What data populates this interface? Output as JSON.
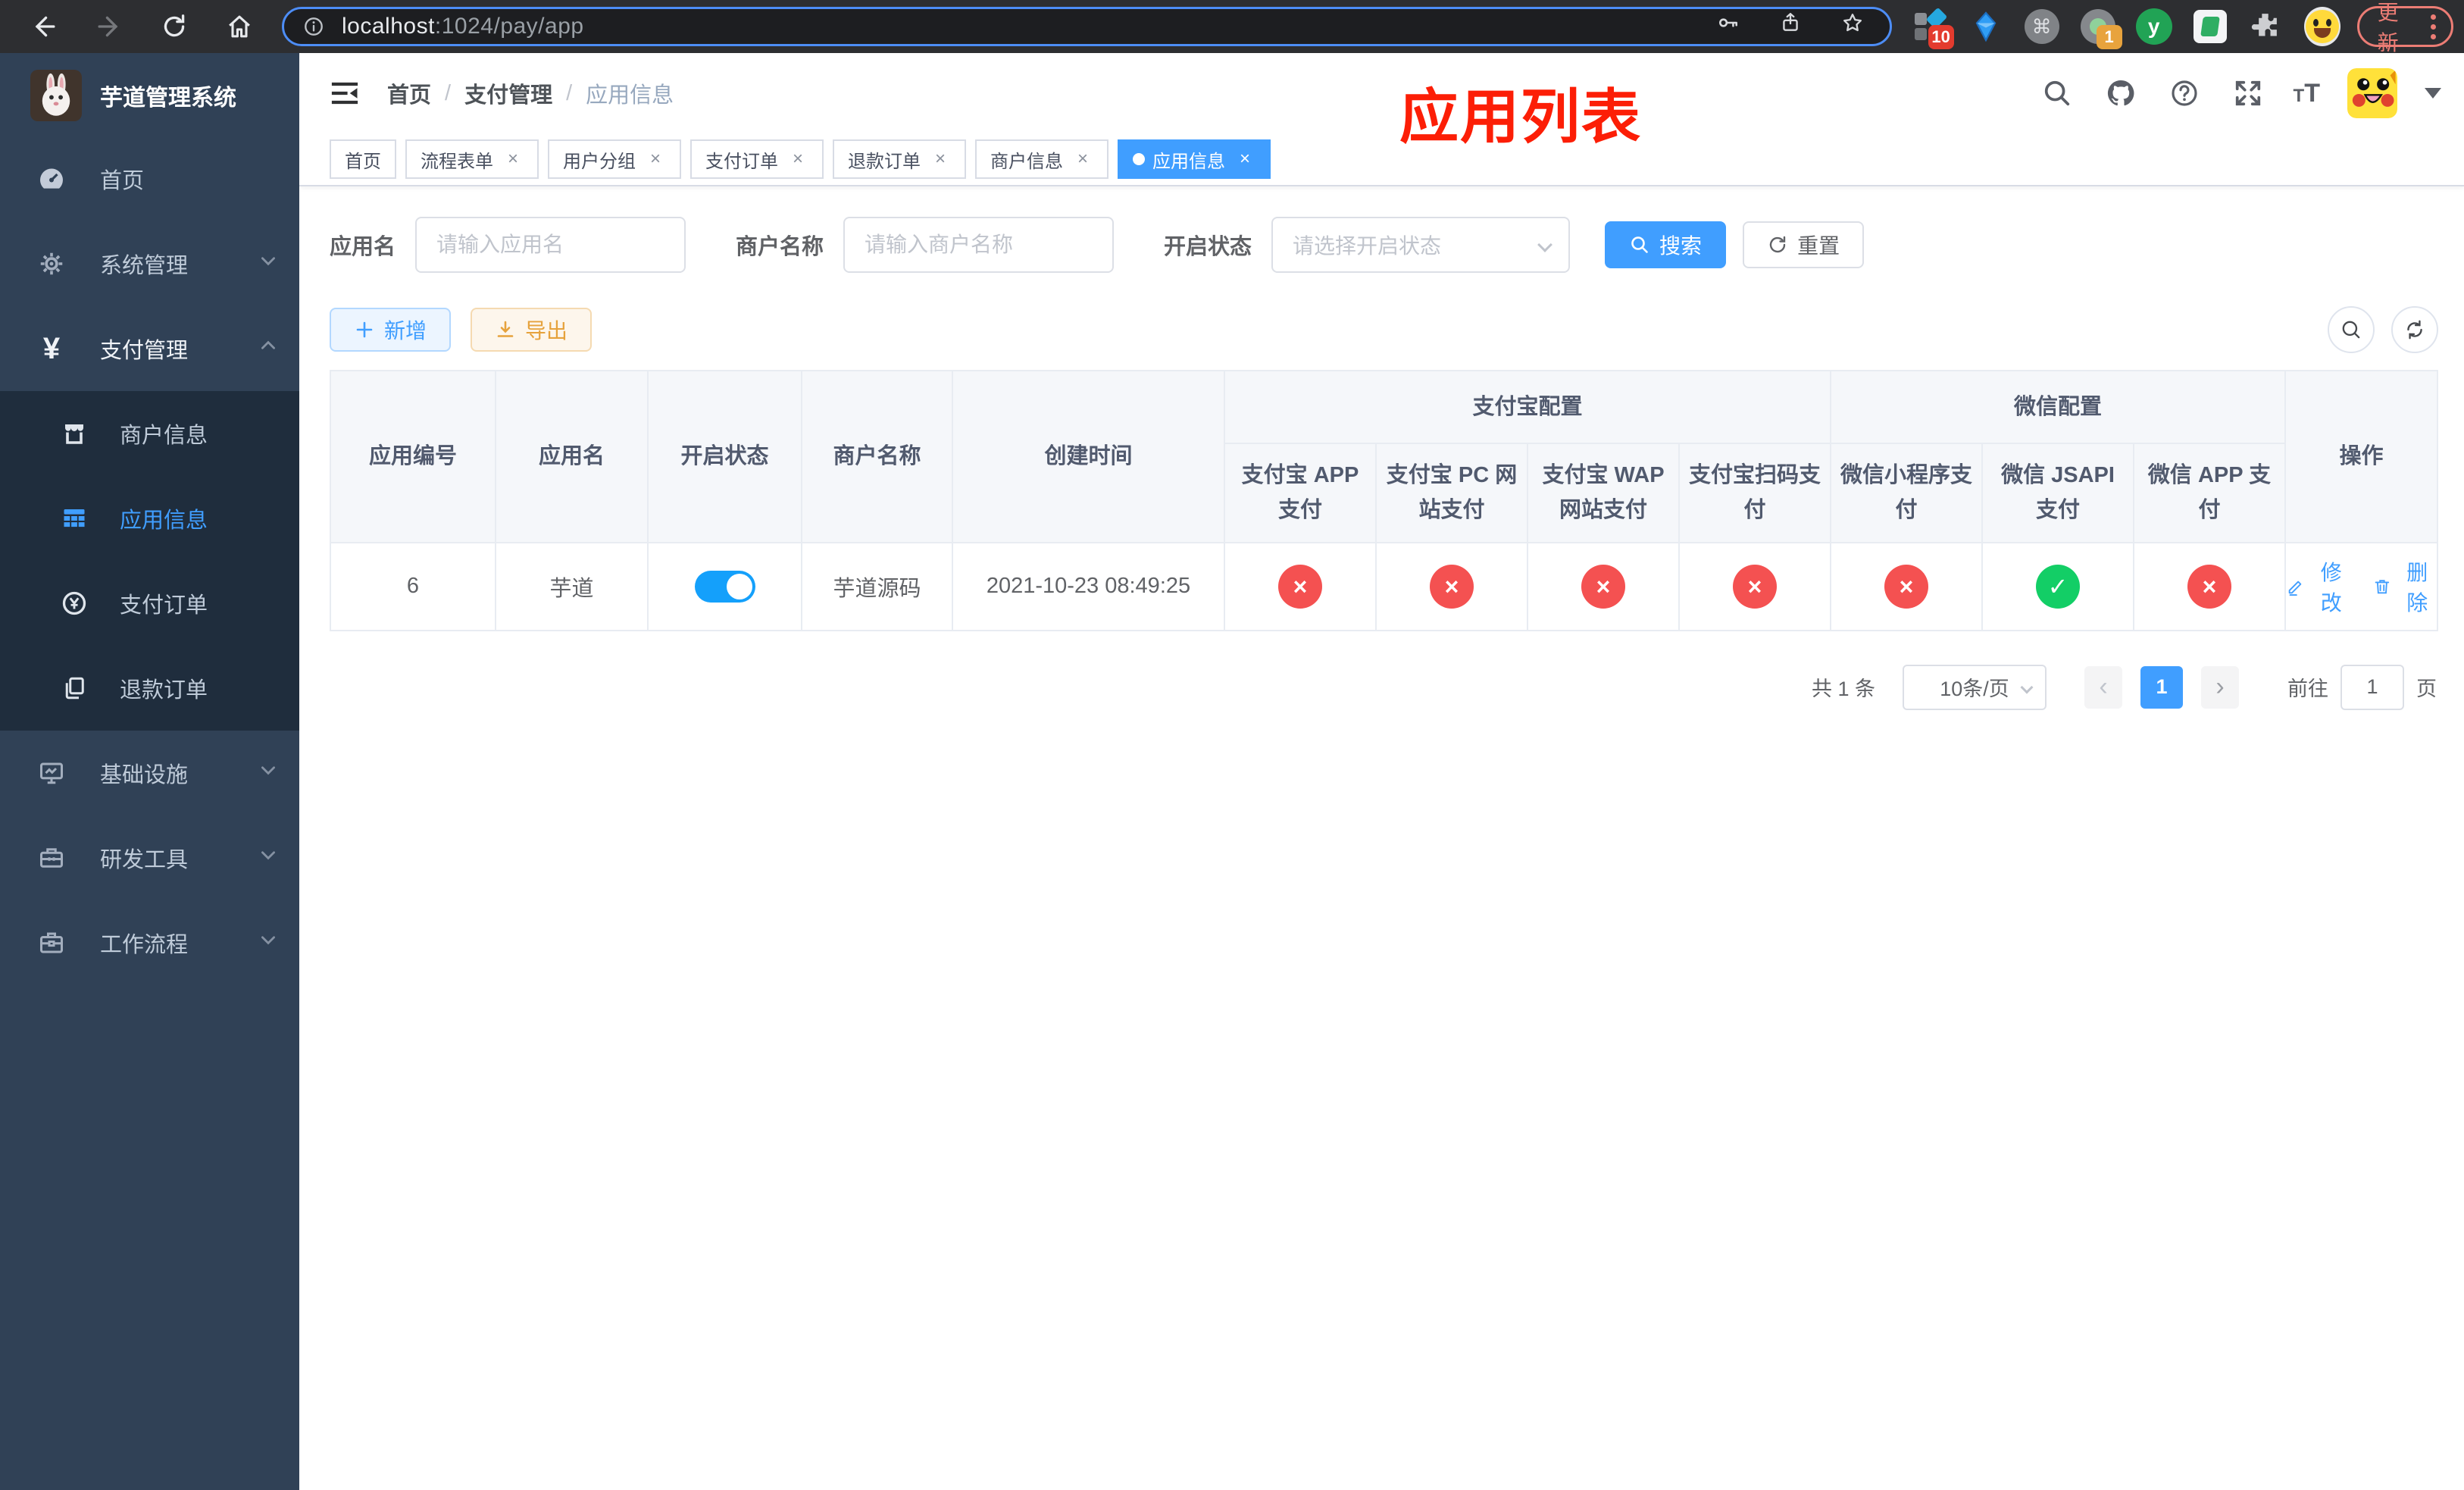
{
  "browser": {
    "url_host": "localhost",
    "url_rest": ":1024/pay/app",
    "ext_grid_badge": "10",
    "ext_avatar_badge": "1",
    "ext_y_glyph": "y",
    "ext_cmd_glyph": "⌘",
    "update_label": "更新"
  },
  "sidebar": {
    "title": "芋道管理系统",
    "items": [
      {
        "label": "首页"
      },
      {
        "label": "系统管理"
      },
      {
        "label": "支付管理"
      },
      {
        "label": "基础设施"
      },
      {
        "label": "研发工具"
      },
      {
        "label": "工作流程"
      }
    ],
    "submenu": [
      {
        "label": "商户信息"
      },
      {
        "label": "应用信息",
        "active": true
      },
      {
        "label": "支付订单"
      },
      {
        "label": "退款订单"
      }
    ]
  },
  "header": {
    "breadcrumb": [
      "首页",
      "支付管理",
      "应用信息"
    ],
    "separator": "/",
    "annotation": "应用列表"
  },
  "tabs": [
    {
      "label": "首页"
    },
    {
      "label": "流程表单"
    },
    {
      "label": "用户分组"
    },
    {
      "label": "支付订单"
    },
    {
      "label": "退款订单"
    },
    {
      "label": "商户信息"
    },
    {
      "label": "应用信息"
    }
  ],
  "tab_close_glyph": "×",
  "filters": {
    "app_name_label": "应用名",
    "app_name_placeholder": "请输入应用名",
    "merchant_label": "商户名称",
    "merchant_placeholder": "请输入商户名称",
    "status_label": "开启状态",
    "status_placeholder": "请选择开启状态",
    "search_label": "搜索",
    "reset_label": "重置"
  },
  "toolbar": {
    "add_label": "新增",
    "export_label": "导出"
  },
  "table": {
    "group_alipay": "支付宝配置",
    "group_wechat": "微信配置",
    "columns": [
      "应用编号",
      "应用名",
      "开启状态",
      "商户名称",
      "创建时间",
      "支付宝 APP 支付",
      "支付宝 PC 网站支付",
      "支付宝 WAP 网站支付",
      "支付宝扫码支付",
      "微信小程序支付",
      "微信 JSAPI 支付",
      "微信 APP 支付",
      "操作"
    ],
    "row": {
      "id": "6",
      "name": "芋道",
      "enabled": true,
      "merchant": "芋道源码",
      "created": "2021-10-23 08:49:25",
      "pay_status": [
        false,
        false,
        false,
        false,
        false,
        true,
        false
      ],
      "edit_label": "修改",
      "delete_label": "删除"
    }
  },
  "pagination": {
    "total": "共 1 条",
    "page_size": "10条/页",
    "prev_glyph": "‹",
    "next_glyph": "›",
    "current_page": "1",
    "goto_label": "前往",
    "goto_value": "1",
    "unit_label": "页"
  },
  "colors": {
    "primary": "#409eff",
    "danger": "#f45151",
    "success": "#13ce66",
    "warning": "#e6a23c",
    "sidebar_bg": "#304156",
    "submenu_bg": "#1f2d3d"
  }
}
